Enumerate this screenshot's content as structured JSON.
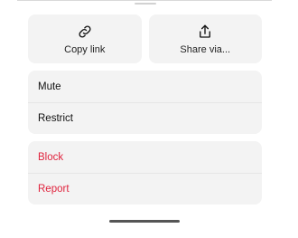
{
  "actions": {
    "copy_link": {
      "label": "Copy link",
      "icon": "link-icon"
    },
    "share_via": {
      "label": "Share via...",
      "icon": "share-icon"
    }
  },
  "menu": {
    "group1": [
      {
        "label": "Mute"
      },
      {
        "label": "Restrict"
      }
    ],
    "group2": [
      {
        "label": "Block"
      },
      {
        "label": "Report"
      }
    ]
  },
  "colors": {
    "danger": "#e0243e",
    "surface": "#f3f3f3"
  }
}
